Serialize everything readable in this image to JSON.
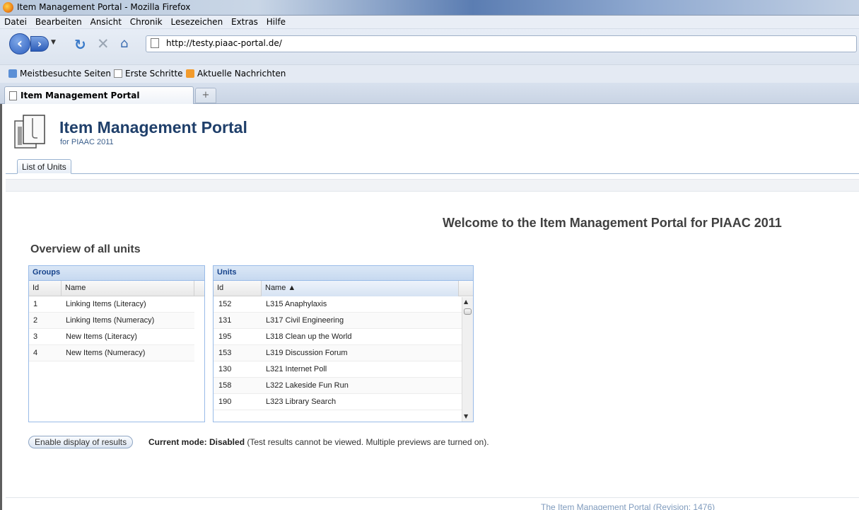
{
  "window": {
    "title": "Item Management Portal - Mozilla Firefox"
  },
  "menu": [
    "Datei",
    "Bearbeiten",
    "Ansicht",
    "Chronik",
    "Lesezeichen",
    "Extras",
    "Hilfe"
  ],
  "nav": {
    "url": "http://testy.piaac-portal.de/"
  },
  "bookmarks": [
    "Meistbesuchte Seiten",
    "Erste Schritte",
    "Aktuelle Nachrichten"
  ],
  "browser_tab": {
    "label": "Item Management Portal",
    "new_tab": "+"
  },
  "portal": {
    "title": "Item Management Portal",
    "subtitle": "for PIAAC 2011",
    "tab": "List of Units",
    "welcome": "Welcome to the Item Management Portal for PIAAC 2011",
    "overview": "Overview of all units"
  },
  "groups": {
    "header": "Groups",
    "columns": [
      "Id",
      "Name"
    ],
    "rows": [
      [
        "1",
        "Linking Items (Literacy)"
      ],
      [
        "2",
        "Linking Items (Numeracy)"
      ],
      [
        "3",
        "New Items (Literacy)"
      ],
      [
        "4",
        "New Items (Numeracy)"
      ]
    ]
  },
  "units": {
    "header": "Units",
    "columns": [
      "Id",
      "Name ▲"
    ],
    "rows": [
      [
        "152",
        "L315 Anaphylaxis"
      ],
      [
        "131",
        "L317 Civil Engineering"
      ],
      [
        "195",
        "L318 Clean up the World"
      ],
      [
        "153",
        "L319 Discussion Forum"
      ],
      [
        "130",
        "L321 Internet Poll"
      ],
      [
        "158",
        "L322 Lakeside Fun Run"
      ],
      [
        "190",
        "L323 Library Search"
      ]
    ]
  },
  "results": {
    "button": "Enable display of results",
    "mode_label": "Current mode: Disabled",
    "mode_detail": " (Test results cannot be viewed. Multiple previews are turned on)."
  },
  "footer": "The Item Management Portal (Revision: 1476)"
}
